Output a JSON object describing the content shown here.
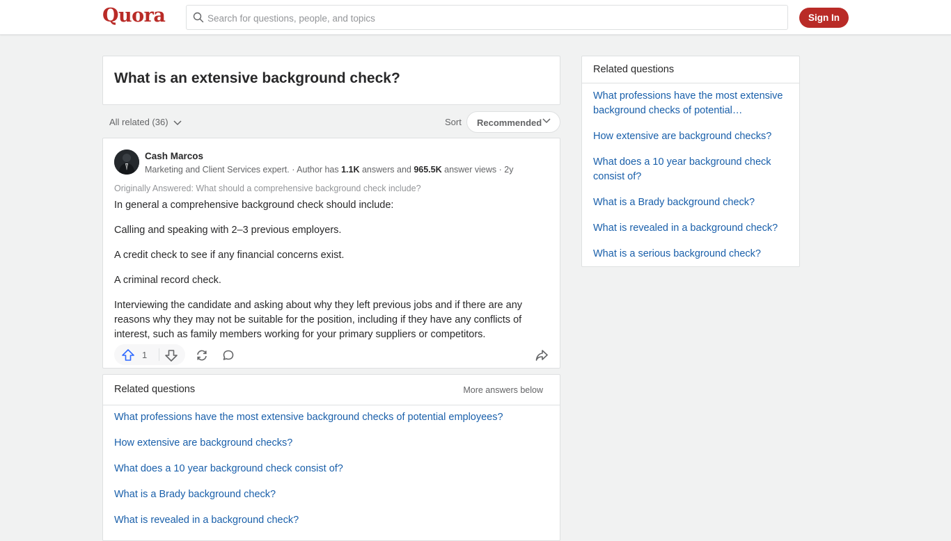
{
  "header": {
    "logo": "Quora",
    "search_placeholder": "Search for questions, people, and topics",
    "signin_label": "Sign In",
    "brand_color": "#b92b27"
  },
  "question": {
    "title": "What is an extensive background check?"
  },
  "filters": {
    "all_related": "All related (36)",
    "sort_label": "Sort",
    "sort_value": "Recommended"
  },
  "answer": {
    "author_name": "Cash Marcos",
    "author_bio": "Marketing and Client Services expert. · Author has ",
    "answers_count": "1.1K",
    "answers_text": " answers and ",
    "views_count": "965.5K",
    "views_text": " answer views · 2y",
    "originally_answered": "Originally Answered: What should a comprehensive background check include?",
    "paragraphs": [
      "In general a comprehensive background check should include:",
      "Calling and speaking with 2–3 previous employers.",
      "A credit check to see if any financial concerns exist.",
      "A criminal record check.",
      "Interviewing the candidate and asking about why they left previous jobs and if there are any reasons why they may not be suitable for the position, including if they have any conflicts of interest, such as family members working for your primary suppliers or competitors."
    ],
    "upvotes": "1",
    "upvote_icon": "arrow-up-icon",
    "downvote_icon": "arrow-down-icon"
  },
  "related_main": {
    "title": "Related questions",
    "more_label": "More answers below",
    "items": [
      "What professions have the most extensive background checks of potential employees?",
      "How extensive are background checks?",
      "What does a 10 year background check consist of?",
      "What is a Brady background check?",
      "What is revealed in a background check?"
    ]
  },
  "sidebar": {
    "title": "Related questions",
    "items": [
      "What professions have the most extensive background checks of potential…",
      "How extensive are background checks?",
      "What does a 10 year background check consist of?",
      "What is a Brady background check?",
      "What is revealed in a background check?",
      "What is a serious background check?"
    ]
  }
}
